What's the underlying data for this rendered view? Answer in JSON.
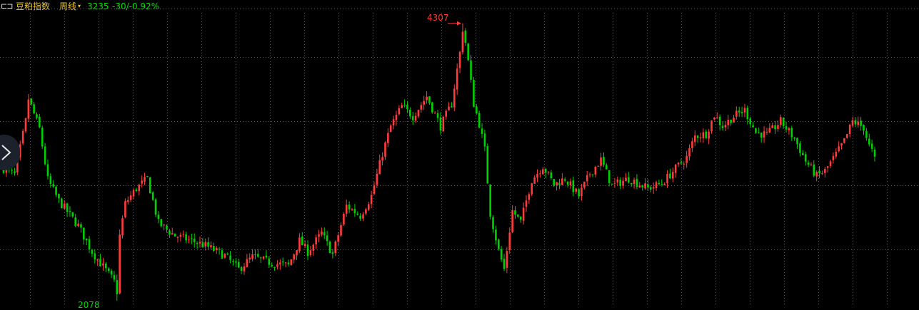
{
  "header": {
    "icon": "⊏⊐",
    "icon_name": "window-toggle-icon",
    "instrument": "豆粕指数",
    "period": "周线",
    "period_caret": "▾",
    "price": "3235",
    "change": "-30/-0.92%"
  },
  "colors": {
    "up": "#ff3b3b",
    "down": "#00d100",
    "grid": "#5a5a5a",
    "header_text": "#f0c419",
    "change_text": "#00e000",
    "background": "#000000"
  },
  "nav": {
    "icon": "chevron-right-icon"
  },
  "chart_data": {
    "type": "candlestick",
    "period": "weekly",
    "instrument": "豆粕指数",
    "ylim": [
      2060,
      4380
    ],
    "grid": true,
    "high_annotation": {
      "label": "4307",
      "value": 4307
    },
    "low_annotation": {
      "label": "2078",
      "value": 2078
    },
    "last_price": 3235,
    "x_index_range": [
      0,
      315
    ],
    "close_path": [
      [
        0,
        3140
      ],
      [
        4,
        3090
      ],
      [
        8,
        3520
      ],
      [
        9,
        3700
      ],
      [
        11,
        3580
      ],
      [
        13,
        3460
      ],
      [
        16,
        3050
      ],
      [
        20,
        2880
      ],
      [
        27,
        2680
      ],
      [
        32,
        2470
      ],
      [
        37,
        2320
      ],
      [
        40,
        2230
      ],
      [
        41,
        2170
      ],
      [
        42,
        2600
      ],
      [
        44,
        2860
      ],
      [
        48,
        2980
      ],
      [
        52,
        3060
      ],
      [
        56,
        2700
      ],
      [
        62,
        2600
      ],
      [
        68,
        2560
      ],
      [
        73,
        2520
      ],
      [
        80,
        2440
      ],
      [
        85,
        2330
      ],
      [
        90,
        2430
      ],
      [
        97,
        2380
      ],
      [
        103,
        2360
      ],
      [
        107,
        2560
      ],
      [
        110,
        2470
      ],
      [
        115,
        2620
      ],
      [
        119,
        2450
      ],
      [
        124,
        2840
      ],
      [
        129,
        2760
      ],
      [
        133,
        2920
      ],
      [
        137,
        3260
      ],
      [
        140,
        3480
      ],
      [
        144,
        3640
      ],
      [
        148,
        3560
      ],
      [
        153,
        3720
      ],
      [
        158,
        3480
      ],
      [
        162,
        3660
      ],
      [
        165,
        4070
      ],
      [
        166,
        4307
      ],
      [
        168,
        4000
      ],
      [
        170,
        3660
      ],
      [
        172,
        3500
      ],
      [
        174,
        3290
      ],
      [
        176,
        2780
      ],
      [
        179,
        2480
      ],
      [
        181,
        2330
      ],
      [
        184,
        2800
      ],
      [
        187,
        2710
      ],
      [
        191,
        3050
      ],
      [
        195,
        3160
      ],
      [
        199,
        3010
      ],
      [
        203,
        3060
      ],
      [
        208,
        2920
      ],
      [
        212,
        3100
      ],
      [
        216,
        3210
      ],
      [
        220,
        3000
      ],
      [
        226,
        3060
      ],
      [
        233,
        2980
      ],
      [
        238,
        3020
      ],
      [
        243,
        3140
      ],
      [
        247,
        3230
      ],
      [
        250,
        3400
      ],
      [
        254,
        3420
      ],
      [
        257,
        3570
      ],
      [
        260,
        3480
      ],
      [
        264,
        3560
      ],
      [
        268,
        3610
      ],
      [
        272,
        3430
      ],
      [
        276,
        3410
      ],
      [
        281,
        3520
      ],
      [
        286,
        3380
      ],
      [
        290,
        3200
      ],
      [
        294,
        3080
      ],
      [
        297,
        3120
      ],
      [
        300,
        3220
      ],
      [
        304,
        3360
      ],
      [
        307,
        3520
      ],
      [
        311,
        3470
      ],
      [
        313,
        3320
      ],
      [
        315,
        3235
      ]
    ]
  }
}
